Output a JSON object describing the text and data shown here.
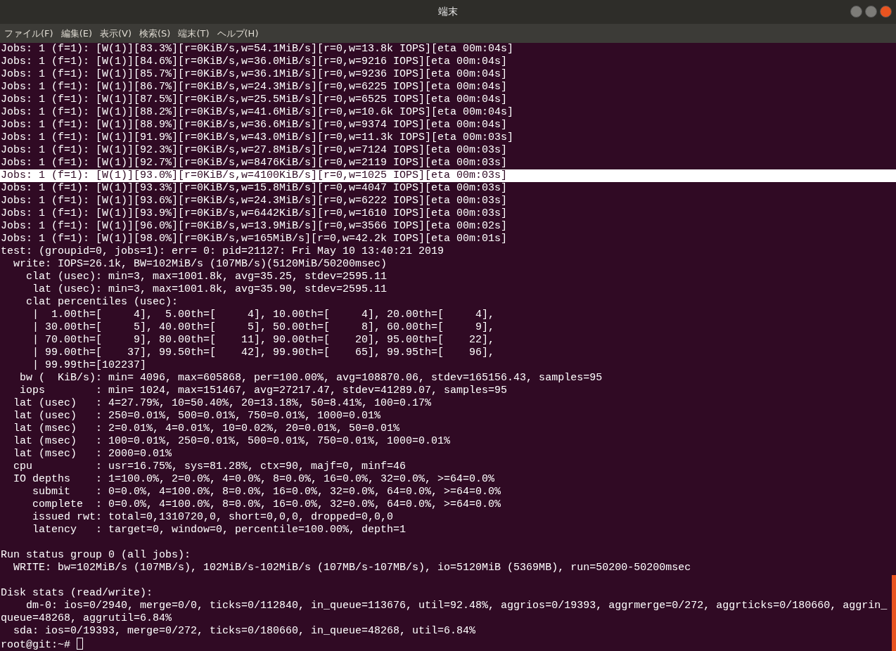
{
  "window": {
    "title": "端末"
  },
  "menu": [
    "ファイル(F)",
    "編集(E)",
    "表示(V)",
    "検索(S)",
    "端末(T)",
    "ヘルプ(H)"
  ],
  "terminal": {
    "blocks": [
      {
        "lines": [
          {
            "text": "Jobs: 1 (f=1): [W(1)][83.3%][r=0KiB/s,w=54.1MiB/s][r=0,w=13.8k IOPS][eta 00m:04s]",
            "selected": false
          },
          {
            "text": "Jobs: 1 (f=1): [W(1)][84.6%][r=0KiB/s,w=36.0MiB/s][r=0,w=9216 IOPS][eta 00m:04s]",
            "selected": false
          },
          {
            "text": "Jobs: 1 (f=1): [W(1)][85.7%][r=0KiB/s,w=36.1MiB/s][r=0,w=9236 IOPS][eta 00m:04s]",
            "selected": false
          },
          {
            "text": "Jobs: 1 (f=1): [W(1)][86.7%][r=0KiB/s,w=24.3MiB/s][r=0,w=6225 IOPS][eta 00m:04s]",
            "selected": false
          },
          {
            "text": "Jobs: 1 (f=1): [W(1)][87.5%][r=0KiB/s,w=25.5MiB/s][r=0,w=6525 IOPS][eta 00m:04s]",
            "selected": false
          },
          {
            "text": "Jobs: 1 (f=1): [W(1)][88.2%][r=0KiB/s,w=41.6MiB/s][r=0,w=10.6k IOPS][eta 00m:04s]",
            "selected": false
          },
          {
            "text": "Jobs: 1 (f=1): [W(1)][88.9%][r=0KiB/s,w=36.6MiB/s][r=0,w=9374 IOPS][eta 00m:04s]",
            "selected": false
          },
          {
            "text": "Jobs: 1 (f=1): [W(1)][91.9%][r=0KiB/s,w=43.0MiB/s][r=0,w=11.3k IOPS][eta 00m:03s]",
            "selected": false
          },
          {
            "text": "Jobs: 1 (f=1): [W(1)][92.3%][r=0KiB/s,w=27.8MiB/s][r=0,w=7124 IOPS][eta 00m:03s]",
            "selected": false
          },
          {
            "text": "Jobs: 1 (f=1): [W(1)][92.7%][r=0KiB/s,w=8476KiB/s][r=0,w=2119 IOPS][eta 00m:03s]",
            "selected": false
          },
          {
            "text": "Jobs: 1 (f=1): [W(1)][93.0%][r=0KiB/s,w=4100KiB/s][r=0,w=1025 IOPS][eta 00m:03s]",
            "selected": true
          },
          {
            "text": "Jobs: 1 (f=1): [W(1)][93.3%][r=0KiB/s,w=15.8MiB/s][r=0,w=4047 IOPS][eta 00m:03s]",
            "selected": false
          },
          {
            "text": "Jobs: 1 (f=1): [W(1)][93.6%][r=0KiB/s,w=24.3MiB/s][r=0,w=6222 IOPS][eta 00m:03s]",
            "selected": false
          },
          {
            "text": "Jobs: 1 (f=1): [W(1)][93.9%][r=0KiB/s,w=6442KiB/s][r=0,w=1610 IOPS][eta 00m:03s]",
            "selected": false
          },
          {
            "text": "Jobs: 1 (f=1): [W(1)][96.0%][r=0KiB/s,w=13.9MiB/s][r=0,w=3566 IOPS][eta 00m:02s]",
            "selected": false
          },
          {
            "text": "Jobs: 1 (f=1): [W(1)][98.0%][r=0KiB/s,w=165MiB/s][r=0,w=42.2k IOPS][eta 00m:01s]",
            "selected": false
          },
          {
            "text": "test: (groupid=0, jobs=1): err= 0: pid=21127: Fri May 10 13:40:21 2019",
            "selected": false
          },
          {
            "text": "  write: IOPS=26.1k, BW=102MiB/s (107MB/s)(5120MiB/50200msec)",
            "selected": false
          },
          {
            "text": "    clat (usec): min=3, max=1001.8k, avg=35.25, stdev=2595.11",
            "selected": false
          },
          {
            "text": "     lat (usec): min=3, max=1001.8k, avg=35.90, stdev=2595.11",
            "selected": false
          },
          {
            "text": "    clat percentiles (usec):",
            "selected": false
          },
          {
            "text": "     |  1.00th=[     4],  5.00th=[     4], 10.00th=[     4], 20.00th=[     4],",
            "selected": false
          },
          {
            "text": "     | 30.00th=[     5], 40.00th=[     5], 50.00th=[     8], 60.00th=[     9],",
            "selected": false
          },
          {
            "text": "     | 70.00th=[     9], 80.00th=[    11], 90.00th=[    20], 95.00th=[    22],",
            "selected": false
          },
          {
            "text": "     | 99.00th=[    37], 99.50th=[    42], 99.90th=[    65], 99.95th=[    96],",
            "selected": false
          },
          {
            "text": "     | 99.99th=[102237]",
            "selected": false
          },
          {
            "text": "   bw (  KiB/s): min= 4096, max=605868, per=100.00%, avg=108870.06, stdev=165156.43, samples=95",
            "selected": false
          },
          {
            "text": "   iops        : min= 1024, max=151467, avg=27217.47, stdev=41289.07, samples=95",
            "selected": false
          },
          {
            "text": "  lat (usec)   : 4=27.79%, 10=50.40%, 20=13.18%, 50=8.41%, 100=0.17%",
            "selected": false
          },
          {
            "text": "  lat (usec)   : 250=0.01%, 500=0.01%, 750=0.01%, 1000=0.01%",
            "selected": false
          },
          {
            "text": "  lat (msec)   : 2=0.01%, 4=0.01%, 10=0.02%, 20=0.01%, 50=0.01%",
            "selected": false
          },
          {
            "text": "  lat (msec)   : 100=0.01%, 250=0.01%, 500=0.01%, 750=0.01%, 1000=0.01%",
            "selected": false
          },
          {
            "text": "  lat (msec)   : 2000=0.01%",
            "selected": false
          },
          {
            "text": "  cpu          : usr=16.75%, sys=81.28%, ctx=90, majf=0, minf=46",
            "selected": false
          },
          {
            "text": "  IO depths    : 1=100.0%, 2=0.0%, 4=0.0%, 8=0.0%, 16=0.0%, 32=0.0%, >=64=0.0%",
            "selected": false
          },
          {
            "text": "     submit    : 0=0.0%, 4=100.0%, 8=0.0%, 16=0.0%, 32=0.0%, 64=0.0%, >=64=0.0%",
            "selected": false
          },
          {
            "text": "     complete  : 0=0.0%, 4=100.0%, 8=0.0%, 16=0.0%, 32=0.0%, 64=0.0%, >=64=0.0%",
            "selected": false
          },
          {
            "text": "     issued rwt: total=0,1310720,0, short=0,0,0, dropped=0,0,0",
            "selected": false
          },
          {
            "text": "     latency   : target=0, window=0, percentile=100.00%, depth=1",
            "selected": false
          }
        ]
      },
      {
        "lines": [
          {
            "text": "Run status group 0 (all jobs):",
            "selected": false
          },
          {
            "text": "  WRITE: bw=102MiB/s (107MB/s), 102MiB/s-102MiB/s (107MB/s-107MB/s), io=5120MiB (5369MB), run=50200-50200msec",
            "selected": false
          }
        ]
      },
      {
        "lines": [
          {
            "text": "Disk stats (read/write):",
            "selected": false
          },
          {
            "text": "    dm-0: ios=0/2940, merge=0/0, ticks=0/112840, in_queue=113676, util=92.48%, aggrios=0/19393, aggrmerge=0/272, aggrticks=0/180660, aggrin_",
            "selected": false
          },
          {
            "text": "queue=48268, aggrutil=6.84%",
            "selected": false
          },
          {
            "text": "  sda: ios=0/19393, merge=0/272, ticks=0/180660, in_queue=48268, util=6.84%",
            "selected": false
          }
        ]
      }
    ],
    "prompt": "root@git:~#"
  }
}
